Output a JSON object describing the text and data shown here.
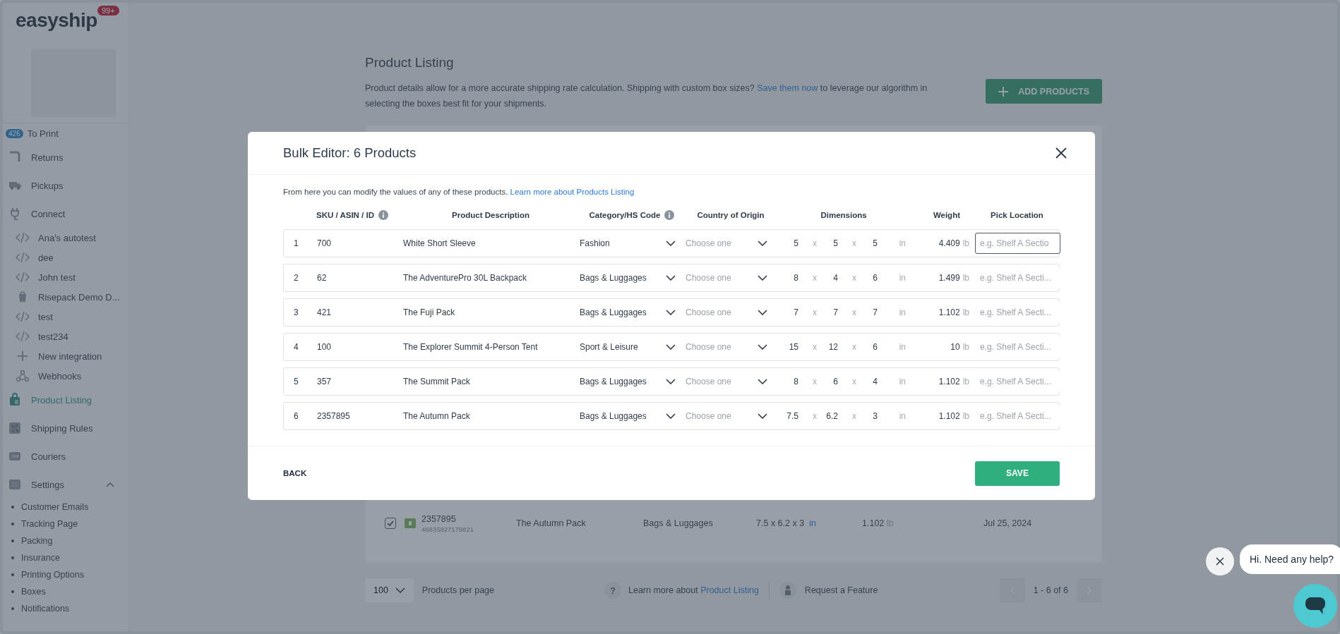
{
  "sidebar": {
    "logo": "easyship",
    "notification_badge": "99+",
    "items": [
      {
        "label": "To Print",
        "badge": "426",
        "selected": false
      },
      {
        "label": "Returns",
        "selected": false
      },
      {
        "label": "Pickups",
        "selected": false
      },
      {
        "label": "Connect",
        "selected": false,
        "children": [
          {
            "label": "Ana's autotest"
          },
          {
            "label": "dee"
          },
          {
            "label": "John test"
          },
          {
            "label": "Risepack Demo D..."
          },
          {
            "label": "test"
          },
          {
            "label": "test234"
          },
          {
            "label": "New integration"
          },
          {
            "label": "Webhooks"
          }
        ]
      },
      {
        "label": "Product Listing",
        "selected": true
      },
      {
        "label": "Shipping Rules",
        "selected": false
      },
      {
        "label": "Couriers",
        "selected": false
      },
      {
        "label": "Settings",
        "selected": false,
        "expanded": true,
        "children": [
          {
            "label": "Customer Emails"
          },
          {
            "label": "Tracking Page"
          },
          {
            "label": "Packing"
          },
          {
            "label": "Insurance"
          },
          {
            "label": "Printing Options"
          },
          {
            "label": "Boxes"
          },
          {
            "label": "Notifications"
          }
        ]
      }
    ]
  },
  "page": {
    "title": "Product Listing",
    "description_before": "Product details allow for a more accurate shipping rate calculation. Shipping with custom box sizes? ",
    "description_link": "Save them now",
    "description_after": " to leverage our algorithm in selecting the boxes best fit for your shipments.",
    "add_button": "ADD PRODUCTS",
    "background_row": {
      "checked": true,
      "sku": "2357895",
      "id": "46835827179821",
      "description": "The Autumn Pack",
      "category": "Bags & Luggages",
      "dims": [
        "7.5",
        "6.2",
        "3"
      ],
      "separators": [
        "x",
        "x"
      ],
      "dim_unit": "in",
      "weight": "1.102",
      "weight_unit": "lb",
      "date": "Jul 25, 2024"
    }
  },
  "footer": {
    "per_page": "100",
    "per_page_label": "Products per page",
    "help_icon": "?",
    "learn_text": "Learn more about ",
    "learn_link": "Product Listing",
    "request": "Request a Feature",
    "pagination": "1 - 6 of 6"
  },
  "modal": {
    "title": "Bulk Editor: 6 Products",
    "intro": "From here you can modify the values of any of these products. ",
    "intro_link": "Learn more about Products Listing",
    "columns": [
      {
        "label": "SKU / ASIN / ID",
        "info": true
      },
      {
        "label": "Product Description",
        "info": false
      },
      {
        "label": "Category/HS Code",
        "info": true
      },
      {
        "label": "Country of Origin",
        "info": false
      },
      {
        "label": "Dimensions",
        "info": false
      },
      {
        "label": "Weight",
        "info": false
      },
      {
        "label": "Pick Location",
        "info": false
      }
    ],
    "rows": [
      {
        "index": "1",
        "sku": "700",
        "description": "White Short Sleeve",
        "category": "Fashion",
        "country_placeholder": "Choose one",
        "dims": [
          "5",
          "5",
          "5"
        ],
        "separators": [
          "x",
          "x"
        ],
        "dim_unit": "in",
        "weight": "4.409",
        "weight_unit": "lb",
        "pick_placeholder": "e.g. Shelf A Sectio",
        "focused": true
      },
      {
        "index": "2",
        "sku": "62",
        "description": "The AdventurePro 30L Backpack",
        "category": "Bags & Luggages",
        "country_placeholder": "Choose one",
        "dims": [
          "8",
          "4",
          "6"
        ],
        "separators": [
          "x",
          "x"
        ],
        "dim_unit": "in",
        "weight": "1.499",
        "weight_unit": "lb",
        "pick_placeholder": "e.g. Shelf A Secti...",
        "focused": false
      },
      {
        "index": "3",
        "sku": "421",
        "description": "The Fuji Pack",
        "category": "Bags & Luggages",
        "country_placeholder": "Choose one",
        "dims": [
          "7",
          "7",
          "7"
        ],
        "separators": [
          "x",
          "x"
        ],
        "dim_unit": "in",
        "weight": "1.102",
        "weight_unit": "lb",
        "pick_placeholder": "e.g. Shelf A Secti...",
        "focused": false
      },
      {
        "index": "4",
        "sku": "100",
        "description": "The Explorer Summit 4-Person Tent",
        "category": "Sport & Leisure",
        "country_placeholder": "Choose one",
        "dims": [
          "15",
          "12",
          "6"
        ],
        "separators": [
          "x",
          "x"
        ],
        "dim_unit": "in",
        "weight": "10",
        "weight_unit": "lb",
        "pick_placeholder": "e.g. Shelf A Secti...",
        "focused": false
      },
      {
        "index": "5",
        "sku": "357",
        "description": "The Summit Pack",
        "category": "Bags & Luggages",
        "country_placeholder": "Choose one",
        "dims": [
          "8",
          "6",
          "4"
        ],
        "separators": [
          "x",
          "x"
        ],
        "dim_unit": "in",
        "weight": "1.102",
        "weight_unit": "lb",
        "pick_placeholder": "e.g. Shelf A Secti...",
        "focused": false
      },
      {
        "index": "6",
        "sku": "2357895",
        "description": "The Autumn Pack",
        "category": "Bags & Luggages",
        "country_placeholder": "Choose one",
        "dims": [
          "7.5",
          "6.2",
          "3"
        ],
        "separators": [
          "x",
          "x"
        ],
        "dim_unit": "in",
        "weight": "1.102",
        "weight_unit": "lb",
        "pick_placeholder": "e.g. Shelf A Secti...",
        "focused": false
      }
    ],
    "back": "BACK",
    "save": "SAVE"
  },
  "chat": {
    "bubble": "Hi. Need any help?"
  }
}
